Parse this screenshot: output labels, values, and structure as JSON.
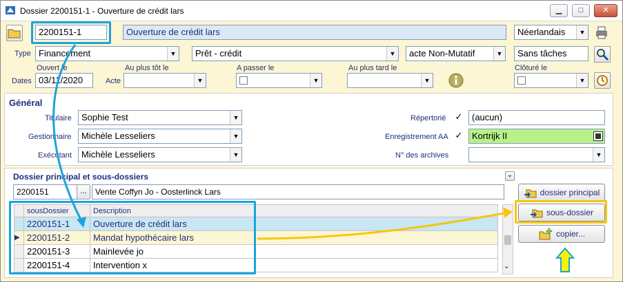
{
  "window": {
    "title": "Dossier 2200151-1 - Ouverture de crédit  lars",
    "minimize": "▁",
    "maximize": "□",
    "close": "✕"
  },
  "header": {
    "dossier_number": "2200151-1",
    "dossier_title": "Ouverture de crédit  lars",
    "language": "Néerlandais"
  },
  "type_row": {
    "label": "Type",
    "type": "Financement",
    "subtype": "Prêt - crédit",
    "act_kind": "acte Non-Mutatif",
    "tasks": "Sans tâches"
  },
  "dates": {
    "label": "Dates",
    "acte_label": "Acte",
    "opened_label": "Ouvert le",
    "opened_value": "03/11/2020",
    "earliest_label": "Au plus tôt le",
    "to_pass_label": "A passer le",
    "latest_label": "Au plus tard le",
    "closed_label": "Clôturé le"
  },
  "general": {
    "title": "Général",
    "titulaire_label": "Titulaire",
    "titulaire": "Sophie Test",
    "gestionnaire_label": "Gestionnaire",
    "gestionnaire": "Michèle Lesseliers",
    "executant_label": "Exécutant",
    "executant": "Michèle Lesseliers",
    "repertorie_label": "Répertorié",
    "repertorie_value": "(aucun)",
    "enregistrement_label": "Enregistrement AA",
    "enregistrement_value": "Kortrijk II",
    "archives_label": "N° des archives",
    "check_mark": "✓"
  },
  "subdossiers": {
    "title": "Dossier principal et sous-dossiers",
    "main_number": "2200151",
    "main_desc": "Vente Coffyn Jo - Oosterlinck Lars",
    "col_sous": "sousDossier",
    "col_desc": "Description",
    "rows": [
      {
        "num": "2200151-1",
        "desc": "Ouverture de crédit  lars"
      },
      {
        "num": "2200151-2",
        "desc": "Mandat hypothécaire  lars"
      },
      {
        "num": "2200151-3",
        "desc": "Mainlevée jo"
      },
      {
        "num": "2200151-4",
        "desc": "Intervention x"
      }
    ],
    "btn_main": "dossier principal",
    "btn_sub": "sous-dossier",
    "btn_copy": "copier...",
    "ellipsis": "...",
    "collapse": "⌄"
  },
  "colors": {
    "highlight_blue": "#1ba3dd",
    "highlight_yellow": "#f5c60f",
    "background": "#fdf6d4",
    "green_field": "#b8f08a"
  }
}
